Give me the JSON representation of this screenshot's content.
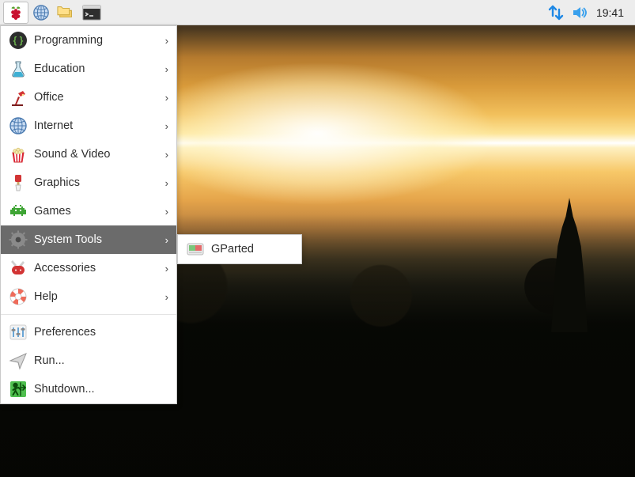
{
  "taskbar": {
    "clock": "19:41"
  },
  "menu": {
    "items": [
      {
        "label": "Programming",
        "icon": "code-braces",
        "submenu": true
      },
      {
        "label": "Education",
        "icon": "flask",
        "submenu": true
      },
      {
        "label": "Office",
        "icon": "desk-lamp",
        "submenu": true
      },
      {
        "label": "Internet",
        "icon": "globe",
        "submenu": true
      },
      {
        "label": "Sound & Video",
        "icon": "popcorn",
        "submenu": true
      },
      {
        "label": "Graphics",
        "icon": "paintbrush",
        "submenu": true
      },
      {
        "label": "Games",
        "icon": "invader",
        "submenu": true
      },
      {
        "label": "System Tools",
        "icon": "gear",
        "submenu": true,
        "selected": true
      },
      {
        "label": "Accessories",
        "icon": "swiss-knife",
        "submenu": true
      },
      {
        "label": "Help",
        "icon": "lifebuoy",
        "submenu": true
      }
    ],
    "footer": [
      {
        "label": "Preferences",
        "icon": "sliders"
      },
      {
        "label": "Run...",
        "icon": "paper-plane"
      },
      {
        "label": "Shutdown...",
        "icon": "exit"
      }
    ]
  },
  "submenu": {
    "items": [
      {
        "label": "GParted",
        "icon": "gparted"
      }
    ]
  }
}
